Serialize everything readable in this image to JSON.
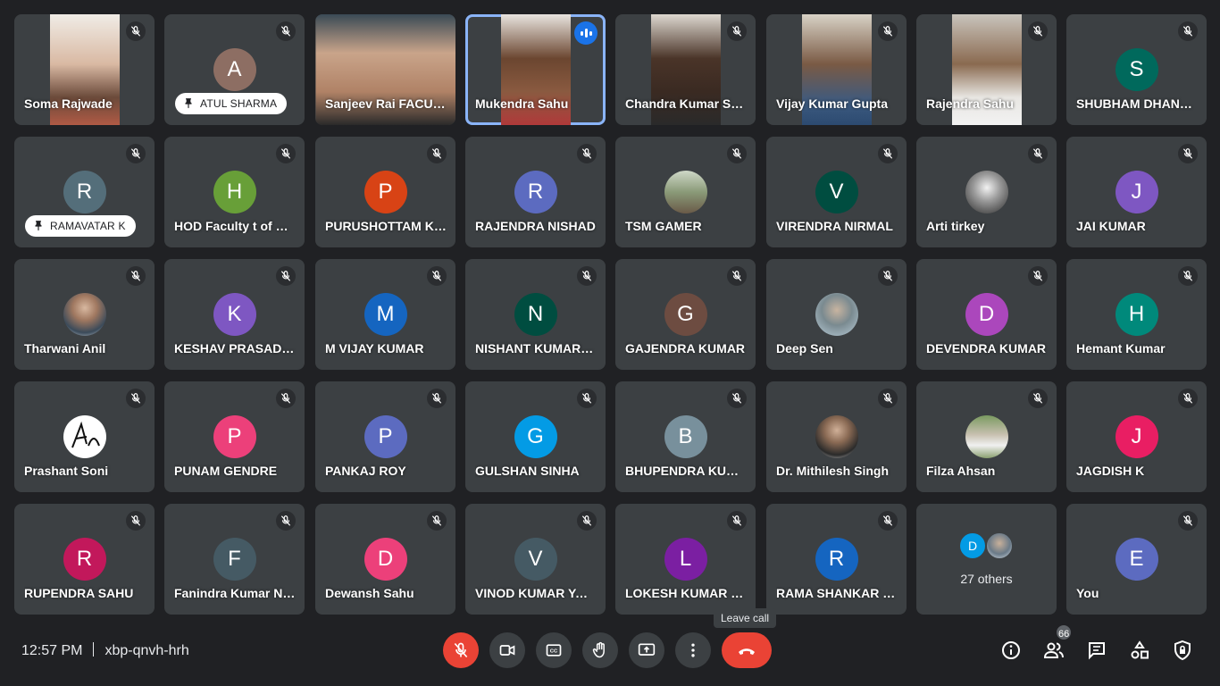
{
  "meeting": {
    "time": "12:57 PM",
    "code": "xbp-qnvh-hrh",
    "participant_count": "66",
    "tooltip": "Leave call"
  },
  "tiles": {
    "t0": {
      "name": "Soma Rajwade"
    },
    "t1": {
      "name": "ATUL SHARMA",
      "initial": "A",
      "color": "#8d6e63"
    },
    "t2": {
      "name": "Sanjeev Rai FACULTY"
    },
    "t3": {
      "name": "Mukendra Sahu"
    },
    "t4": {
      "name": "Chandra Kumar Sahu"
    },
    "t5": {
      "name": "Vijay Kumar Gupta"
    },
    "t6": {
      "name": "Rajendra Sahu"
    },
    "t7": {
      "name": "SHUBHAM DHANKAR",
      "initial": "S",
      "color": "#00695c"
    },
    "t8": {
      "name": "RAMAVATAR K",
      "initial": "R",
      "color": "#546e7a"
    },
    "t9": {
      "name": "HOD Faculty t of Education",
      "initial": "H",
      "color": "#689f38"
    },
    "t10": {
      "name": "PURUSHOTTAM KUMAR",
      "initial": "P",
      "color": "#d84315"
    },
    "t11": {
      "name": "RAJENDRA NISHAD",
      "initial": "R",
      "color": "#5c6bc0"
    },
    "t12": {
      "name": "TSM GAMER"
    },
    "t13": {
      "name": "VIRENDRA NIRMAL",
      "initial": "V",
      "color": "#00695c"
    },
    "t14": {
      "name": "Arti tirkey"
    },
    "t15": {
      "name": "JAI KUMAR",
      "initial": "J",
      "color": "#7e57c2"
    },
    "t16": {
      "name": "Tharwani Anil"
    },
    "t17": {
      "name": "KESHAV PRASAD SAHU",
      "initial": "K",
      "color": "#7e57c2"
    },
    "t18": {
      "name": "M VIJAY KUMAR",
      "initial": "M",
      "color": "#1565c0"
    },
    "t19": {
      "name": "NISHANT KUMAR SAHU",
      "initial": "N",
      "color": "#004d40"
    },
    "t20": {
      "name": "GAJENDRA KUMAR",
      "initial": "G",
      "color": "#6d4c41"
    },
    "t21": {
      "name": "Deep Sen"
    },
    "t22": {
      "name": "DEVENDRA KUMAR",
      "initial": "D",
      "color": "#ab47bc"
    },
    "t23": {
      "name": "Hemant Kumar",
      "initial": "H",
      "color": "#00897b"
    },
    "t24": {
      "name": "Prashant Soni"
    },
    "t25": {
      "name": "PUNAM GENDRE",
      "initial": "P",
      "color": "#ec407a"
    },
    "t26": {
      "name": "PANKAJ ROY",
      "initial": "P",
      "color": "#5c6bc0"
    },
    "t27": {
      "name": "GULSHAN SINHA",
      "initial": "G",
      "color": "#039be5"
    },
    "t28": {
      "name": "BHUPENDRA KUMAR",
      "initial": "B",
      "color": "#78909c"
    },
    "t29": {
      "name": "Dr. Mithilesh Singh"
    },
    "t30": {
      "name": "Filza Ahsan"
    },
    "t31": {
      "name": "JAGDISH K",
      "initial": "J",
      "color": "#e91e63"
    },
    "t32": {
      "name": "RUPENDRA SAHU",
      "initial": "R",
      "color": "#c2185b"
    },
    "t33": {
      "name": "Fanindra Kumar Nishad",
      "initial": "F",
      "color": "#455a64"
    },
    "t34": {
      "name": "Dewansh Sahu",
      "initial": "D",
      "color": "#ec407a"
    },
    "t35": {
      "name": "VINOD KUMAR YADAV",
      "initial": "V",
      "color": "#455a64"
    },
    "t36": {
      "name": "LOKESH KUMAR SAHU",
      "initial": "L",
      "color": "#7b1fa2"
    },
    "t37": {
      "name": "RAMA SHANKAR SAHU",
      "initial": "R",
      "color": "#1565c0"
    },
    "t38": {
      "label": "27 others",
      "initial": "D",
      "color": "#039be5"
    },
    "t39": {
      "name": "You",
      "initial": "E",
      "color": "#5c6bc0"
    }
  },
  "toolbar": [
    "microphone-off",
    "camera",
    "closed-captions",
    "raise-hand",
    "present-screen",
    "more-options",
    "leave-call"
  ],
  "side_icons": [
    "meeting-details",
    "people",
    "chat",
    "activities",
    "host-controls"
  ]
}
